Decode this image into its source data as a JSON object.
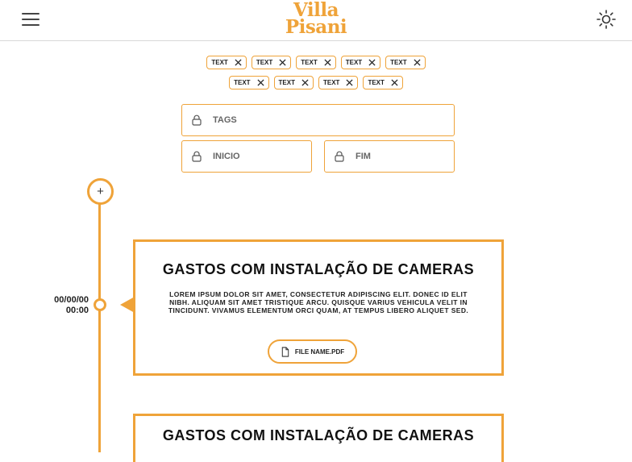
{
  "header": {
    "logo_line1": "Villa",
    "logo_line2": "Pisani",
    "menu_icon": "hamburger-menu-icon",
    "theme_icon": "sun-icon"
  },
  "chips": {
    "row1": [
      {
        "label": "TEXT"
      },
      {
        "label": "TEXT"
      },
      {
        "label": "TEXT"
      },
      {
        "label": "TEXT"
      },
      {
        "label": "TEXT"
      }
    ],
    "row2": [
      {
        "label": "TEXT"
      },
      {
        "label": "TEXT"
      },
      {
        "label": "TEXT"
      },
      {
        "label": "TEXT"
      }
    ],
    "remove_icon": "close-icon"
  },
  "filters": {
    "tags_placeholder": "TAGS",
    "start_placeholder": "INICIO",
    "end_placeholder": "FIM",
    "field_icon": "lock-icon"
  },
  "timeline": {
    "add_label": "+",
    "entry_date": "00/00/00",
    "entry_time": "00:00"
  },
  "cards": [
    {
      "title": "GASTOS COM INSTALAÇÃO DE CAMERAS",
      "description": "LOREM IPSUM DOLOR SIT AMET, CONSECTETUR ADIPISCING ELIT. DONEC ID ELIT NIBH. ALIQUAM SIT AMET TRISTIQUE ARCU. QUISQUE VARIUS VEHICULA VELIT IN TINCIDUNT. VIVAMUS ELEMENTUM ORCI QUAM, AT TEMPUS LIBERO ALIQUET SED.",
      "file_name": "FILE NAME.PDF"
    },
    {
      "title": "GASTOS COM INSTALAÇÃO DE CAMERAS"
    }
  ],
  "colors": {
    "accent": "#EFA339",
    "text": "#111111",
    "border": "#D8D8D8"
  }
}
